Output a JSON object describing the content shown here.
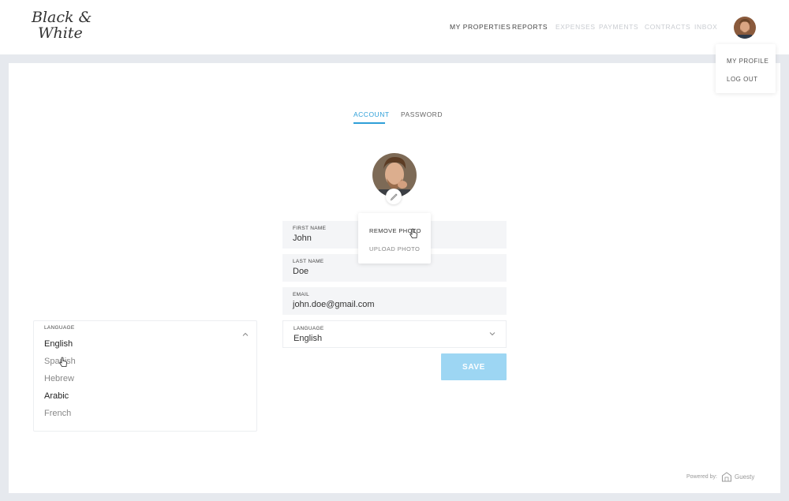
{
  "brand": {
    "logo_line1": "Black &",
    "logo_line2": "White"
  },
  "nav": {
    "items": [
      {
        "label": "MY PROPERTIES",
        "active": true
      },
      {
        "label": "REPORTS",
        "active": true
      },
      {
        "label": "EXPENSES",
        "active": false
      },
      {
        "label": "PAYMENTS",
        "active": false
      },
      {
        "label": "CONTRACTS",
        "active": false
      },
      {
        "label": "INBOX",
        "active": false
      }
    ]
  },
  "profile_menu": {
    "my_profile": "MY PROFILE",
    "log_out": "LOG OUT"
  },
  "tabs": {
    "account": "ACCOUNT",
    "password": "PASSWORD"
  },
  "photo_menu": {
    "remove": "REMOVE PHOTO",
    "upload": "UPLOAD PHOTO"
  },
  "form": {
    "first_name": {
      "label": "FIRST NAME",
      "value": "John"
    },
    "last_name": {
      "label": "LAST NAME",
      "value": "Doe"
    },
    "email": {
      "label": "EMAIL",
      "value": "john.doe@gmail.com"
    },
    "language": {
      "label": "LANGUAGE",
      "value": "English"
    },
    "save_label": "SAVE"
  },
  "language_dropdown": {
    "label": "LANGUAGE",
    "options": [
      "English",
      "Spanish",
      "Hebrew",
      "Arabic",
      "French"
    ]
  },
  "footer": {
    "powered_by": "Powered by:",
    "brand": "Guesty"
  },
  "colors": {
    "accent": "#2e9fd8",
    "save_button": "#9dd6f3",
    "page_bg": "#e6e9ee",
    "field_bg": "#f4f5f7"
  },
  "icons": [
    "avatar",
    "edit-pencil-icon",
    "chevron-down-icon",
    "chevron-up-icon",
    "guesty-logo-icon",
    "hand-cursor-icon"
  ]
}
